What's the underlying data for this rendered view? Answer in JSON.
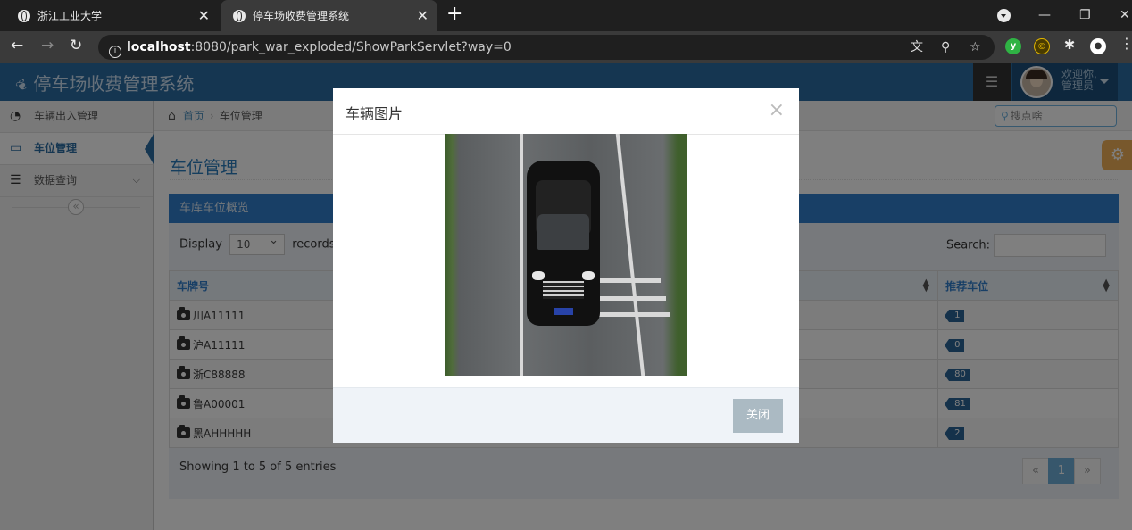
{
  "browser": {
    "tabs": [
      {
        "title": "浙江工业大学"
      },
      {
        "title": "停车场收费管理系统"
      }
    ],
    "url_host": "localhost",
    "url_rest": ":8080/park_war_exploded/ShowParkServlet?way=0"
  },
  "header": {
    "brand": "停车场收费管理系统",
    "welcome_line1": "欢迎你,",
    "welcome_line2": "管理员"
  },
  "sidebar": {
    "items": [
      {
        "label": "车辆出入管理",
        "icon": "dashboard-icon"
      },
      {
        "label": "车位管理",
        "icon": "monitor-icon"
      },
      {
        "label": "数据查询",
        "icon": "list-icon"
      }
    ]
  },
  "breadcrumb": {
    "home": "首页",
    "current": "车位管理"
  },
  "search": {
    "placeholder": "搜点啥"
  },
  "main": {
    "page_title": "车位管理",
    "box_title": "车库车位概览",
    "display_label": "Display",
    "display_value": "10",
    "records_label": "records",
    "search_label": "Search:",
    "columns": [
      "车牌号",
      "推荐车位"
    ],
    "rows": [
      {
        "plate": "川A11111",
        "spot": "1"
      },
      {
        "plate": "沪A11111",
        "spot": "0"
      },
      {
        "plate": "浙C88888",
        "spot": "80"
      },
      {
        "plate": "鲁A00001",
        "spot": "81"
      },
      {
        "plate": "黑AHHHHH",
        "spot": "2"
      }
    ],
    "showing": "Showing 1 to 5 of 5 entries",
    "pager": {
      "prev": "«",
      "current": "1",
      "next": "»"
    }
  },
  "modal": {
    "title": "车辆图片",
    "close_x": "×",
    "close_button": "关闭"
  },
  "colors": {
    "header_blue": "#2b6ca3",
    "box_head_blue": "#307ecc",
    "tag_blue": "#2a6496",
    "gear_orange": "#f0b158"
  }
}
